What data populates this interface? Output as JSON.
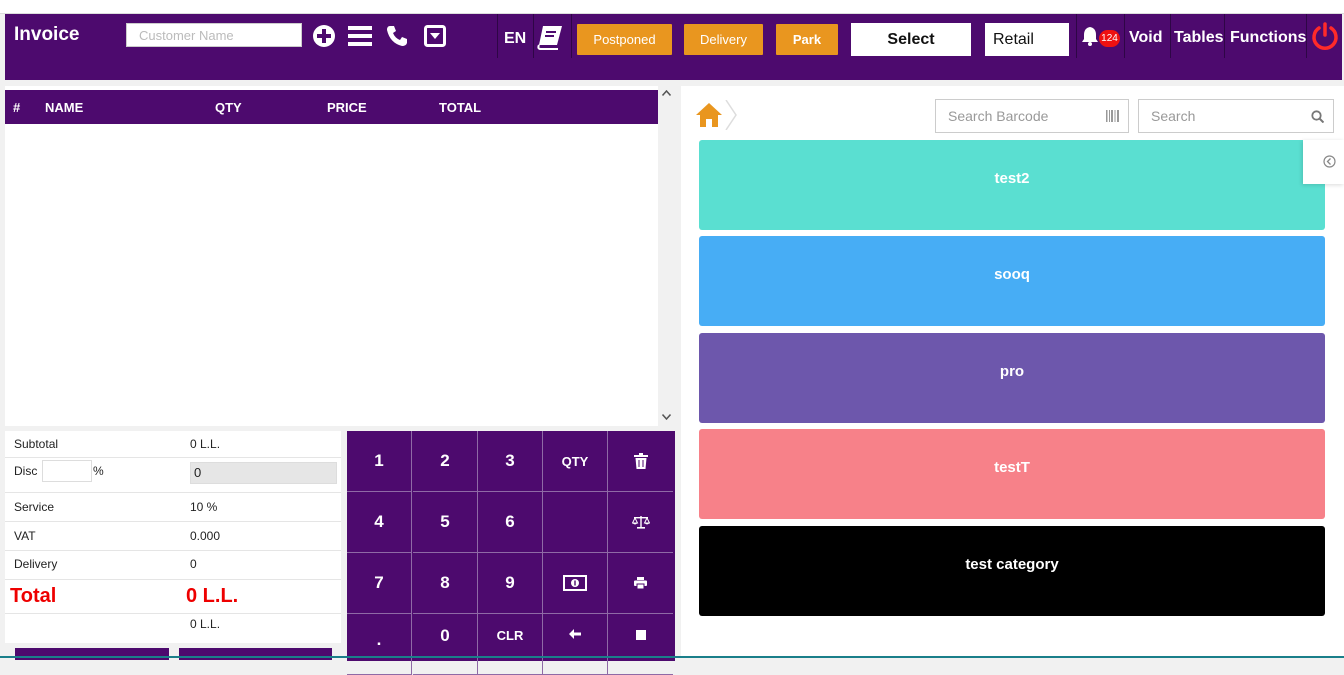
{
  "header": {
    "title": "Invoice",
    "customer_placeholder": "Customer Name",
    "language": "EN",
    "buttons": {
      "postponed": "Postponed",
      "delivery": "Delivery",
      "park": "Park"
    },
    "select_value": "Select",
    "mode_value": "Retail",
    "notification_count": "124",
    "void": "Void",
    "tables": "Tables",
    "functions": "Functions"
  },
  "order_table": {
    "columns": [
      "#",
      "NAME",
      "QTY",
      "PRICE",
      "TOTAL"
    ],
    "rows": []
  },
  "summary": {
    "subtotal_label": "Subtotal",
    "subtotal_value": "0 L.L.",
    "disc_label": "Disc",
    "disc_pct": "%",
    "disc_value": "0",
    "service_label": "Service",
    "service_value": "10 %",
    "vat_label": "VAT",
    "vat_value": "0.000",
    "delivery_label": "Delivery",
    "delivery_value": "0",
    "total_label": "Total",
    "total_value": "0 L.L.",
    "extra_value": "0 L.L."
  },
  "keypad": {
    "k1": "1",
    "k2": "2",
    "k3": "3",
    "qty": "QTY",
    "k4": "4",
    "k5": "5",
    "k6": "6",
    "k7": "7",
    "k8": "8",
    "k9": "9",
    "k0": "0",
    "clr": "CLR"
  },
  "products": {
    "barcode_placeholder": "Search Barcode",
    "search_placeholder": "Search",
    "categories": [
      {
        "name": "test2",
        "color": "#5adfd1"
      },
      {
        "name": "sooq",
        "color": "#47adf5"
      },
      {
        "name": "pro",
        "color": "#6d57ac"
      },
      {
        "name": "testT",
        "color": "#f78189"
      },
      {
        "name": "test category",
        "color": "#000000"
      }
    ]
  },
  "colors": {
    "brand": "#4d0a6e",
    "accent": "#e9961f",
    "danger": "#e00000"
  }
}
